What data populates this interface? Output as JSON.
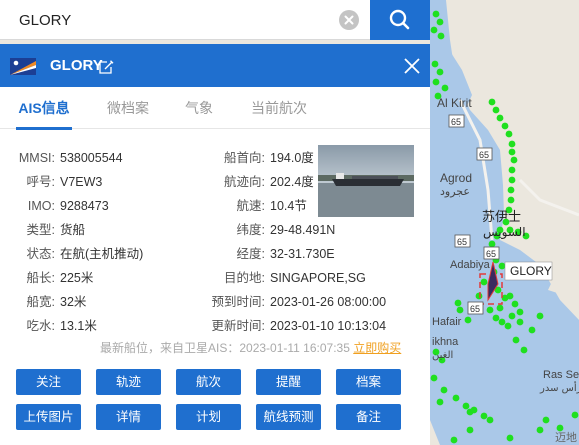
{
  "search": {
    "value": "GLORY"
  },
  "panel": {
    "ship_name": "GLORY",
    "tabs": [
      {
        "label": "AIS信息"
      },
      {
        "label": "微档案"
      },
      {
        "label": "气象"
      },
      {
        "label": "当前航次"
      }
    ],
    "left_fields": [
      {
        "label": "MMSI:",
        "value": "538005544"
      },
      {
        "label": "呼号:",
        "value": "V7EW3"
      },
      {
        "label": "IMO:",
        "value": "9288473"
      },
      {
        "label": "类型:",
        "value": "货船"
      },
      {
        "label": "状态:",
        "value": "在航(主机推动)"
      },
      {
        "label": "船长:",
        "value": "225米"
      },
      {
        "label": "船宽:",
        "value": "32米"
      },
      {
        "label": "吃水:",
        "value": "13.1米"
      }
    ],
    "right_fields": [
      {
        "label": "船首向:",
        "value": "194.0度"
      },
      {
        "label": "航迹向:",
        "value": "202.4度"
      },
      {
        "label": "航速:",
        "value": "10.4节"
      },
      {
        "label": "纬度:",
        "value": "29-48.491N"
      },
      {
        "label": "经度:",
        "value": "32-31.730E"
      },
      {
        "label": "目的地:",
        "value": "SINGAPORE,SG"
      },
      {
        "label": "预到时间:",
        "value": "2023-01-26 08:00:00"
      },
      {
        "label": "更新时间:",
        "value": "2023-01-10 10:13:04"
      }
    ],
    "source_text": "最新船位，来自卫星AIS：2023-01-11 16:07:35",
    "buy_link": "立即购买",
    "buttons_row1": [
      "关注",
      "轨迹",
      "航次",
      "提醒",
      "档案"
    ],
    "buttons_row2": [
      "上传图片",
      "详情",
      "计划",
      "航线预测",
      "备注"
    ]
  },
  "map": {
    "labels": {
      "al_kirit": "Al Kirit",
      "suez_cn": "苏伊士",
      "suez_ar": "السويس",
      "agrod_en": "Agrod",
      "agrod_ar": "عجرود",
      "adabiya": "Adabiya",
      "hafair": "Hafair",
      "ras_sedr": "Ras Se",
      "ras_sedr_ar": "رأس سدر",
      "ikhna": "ikhna",
      "ikhna_ar": "الغين",
      "top_ar": "سنس",
      "road_65a": "65",
      "road_65b": "65",
      "road_65c": "65",
      "road_65d": "65",
      "road_65e": "65",
      "ship_label": "GLORY",
      "attribution": "迈地"
    },
    "colors": {
      "water": "#aac8e8",
      "land": "#ebe7de",
      "ais_dot": "#1fe01f",
      "ship_box": "#e23a3a"
    }
  }
}
